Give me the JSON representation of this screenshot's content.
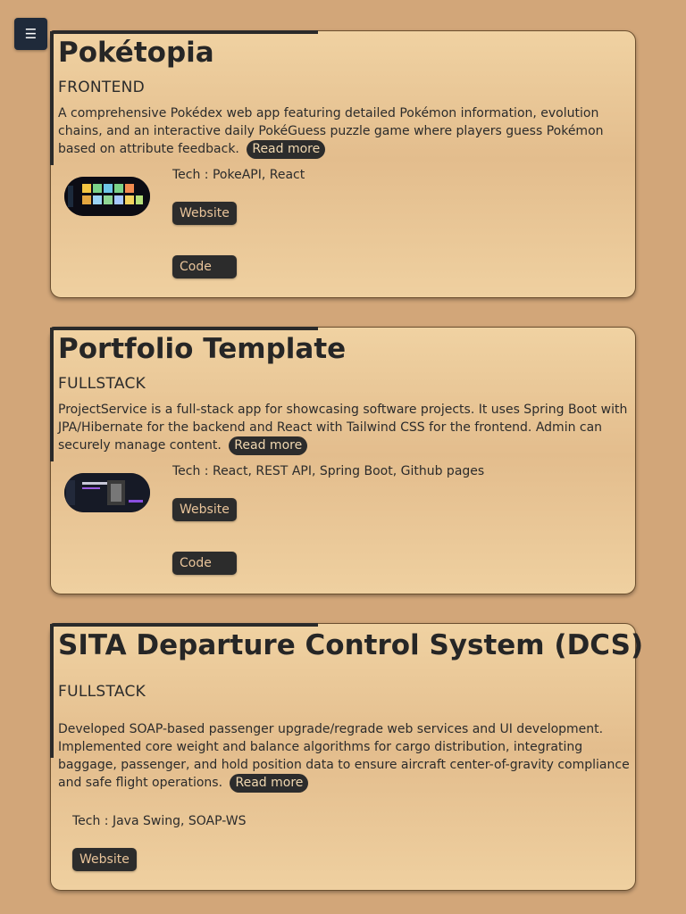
{
  "menu": {
    "icon": "hamburger-icon",
    "glyph": "☰"
  },
  "projects": [
    {
      "title": "Pokétopia",
      "category": "FRONTEND",
      "description": "A comprehensive Pokédex web app featuring detailed Pokémon information, evolution chains, and an interactive daily PokéGuess puzzle game where players guess Pokémon based on attribute feedback.",
      "read_more": "Read more",
      "tech": "Tech : PokeAPI, React",
      "website_label": "Website",
      "code_label": "Code"
    },
    {
      "title": "Portfolio Template",
      "category": "FULLSTACK",
      "description": "ProjectService is a full-stack app for showcasing software projects. It uses Spring Boot with JPA/Hibernate for the backend and React with Tailwind CSS for the frontend. Admin can securely manage content.",
      "read_more": "Read more",
      "tech": "Tech : React, REST API, Spring Boot, Github pages",
      "website_label": "Website",
      "code_label": "Code"
    },
    {
      "title": "SITA Departure Control System (DCS)",
      "category": "FULLSTACK",
      "description": "Developed SOAP-based passenger upgrade/regrade web services and UI development. Implemented core weight and balance algorithms for cargo distribution, integrating baggage, passenger, and hold position data to ensure aircraft center-of-gravity compliance and safe flight operations.",
      "read_more": "Read more",
      "tech": "Tech : Java Swing, SOAP-WS",
      "website_label": "Website"
    }
  ]
}
